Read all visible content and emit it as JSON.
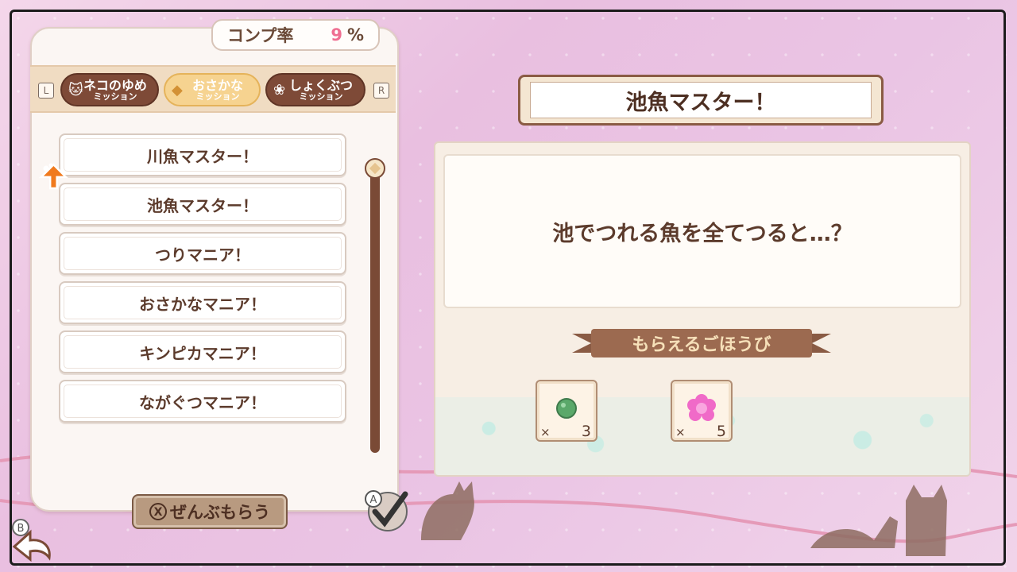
{
  "completion": {
    "label": "コンプ率",
    "value": "9",
    "unit": "%"
  },
  "shoulder": {
    "left": "L",
    "right": "R"
  },
  "tabs": [
    {
      "line1": "ネコのゆめ",
      "line2": "ミッション",
      "icon": "cat-icon",
      "state": "normal"
    },
    {
      "line1": "おさかな",
      "line2": "ミッション",
      "icon": "fish-icon",
      "state": "selected"
    },
    {
      "line1": "しょくぶつ",
      "line2": "ミッション",
      "icon": "flower-icon",
      "state": "normal"
    }
  ],
  "missions": [
    "川魚マスター！",
    "池魚マスター！",
    "つりマニア！",
    "おさかなマニア！",
    "キンピカマニア！",
    "ながぐつマニア！"
  ],
  "selected_mission_index": 1,
  "detail": {
    "title": "池魚マスター！",
    "description": "池でつれる魚を全てつると…？",
    "reward_heading": "もらえるごほうび",
    "rewards": [
      {
        "icon": "green-gem-icon",
        "mult": "×",
        "count": "3"
      },
      {
        "icon": "pink-flower-icon",
        "mult": "×",
        "count": "5"
      }
    ]
  },
  "buttons": {
    "claim_all_key": "X",
    "claim_all_label": "ぜんぶもらう",
    "back_key": "B",
    "confirm_key": "A"
  },
  "colors": {
    "accent_dark": "#7e4a37",
    "accent_light": "#f6d390",
    "percent": "#ef6f92"
  }
}
